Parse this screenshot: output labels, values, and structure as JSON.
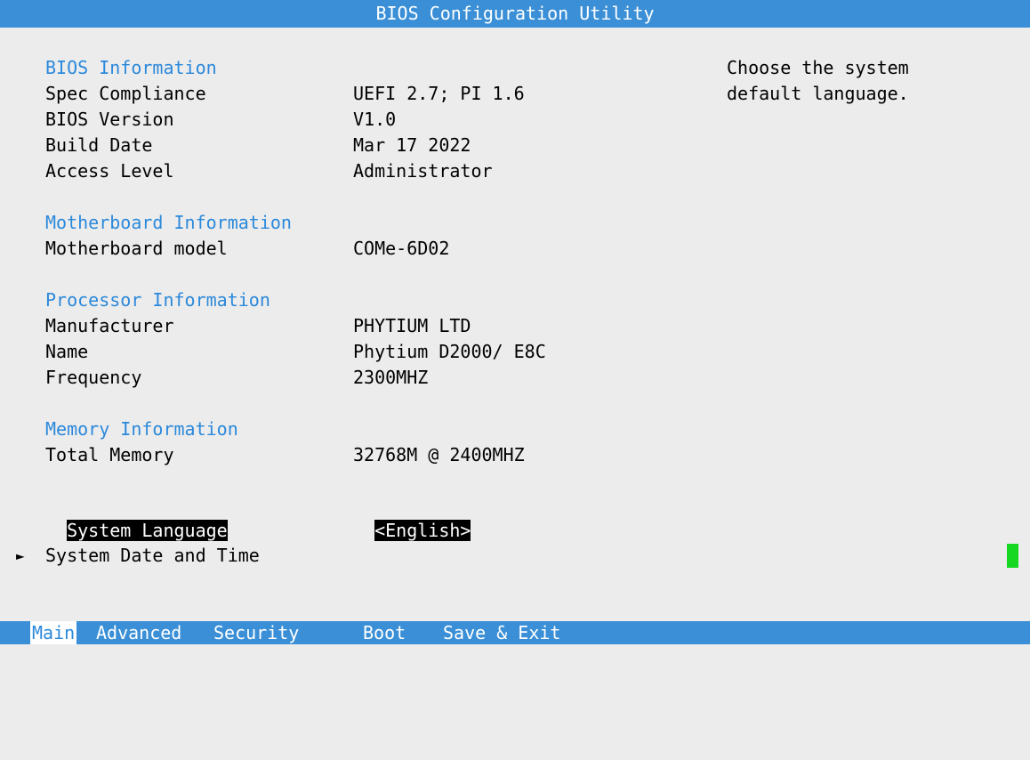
{
  "header": {
    "title": "BIOS Configuration Utility"
  },
  "sections": {
    "bios": {
      "heading": "BIOS Information",
      "rows": [
        {
          "label": "Spec Compliance",
          "value": "UEFI 2.7; PI 1.6"
        },
        {
          "label": "BIOS Version",
          "value": "V1.0"
        },
        {
          "label": "Build Date",
          "value": "Mar 17 2022"
        },
        {
          "label": "Access Level",
          "value": "Administrator"
        }
      ]
    },
    "motherboard": {
      "heading": "Motherboard Information",
      "rows": [
        {
          "label": "Motherboard model",
          "value": "COMe-6D02"
        }
      ]
    },
    "processor": {
      "heading": "Processor Information",
      "rows": [
        {
          "label": "Manufacturer",
          "value": "PHYTIUM LTD"
        },
        {
          "label": "Name",
          "value": "Phytium D2000/ E8C"
        },
        {
          "label": "Frequency",
          "value": "2300MHZ"
        }
      ]
    },
    "memory": {
      "heading": "Memory Information",
      "rows": [
        {
          "label": "Total Memory",
          "value": "32768M @ 2400MHZ"
        }
      ]
    }
  },
  "language": {
    "label": "System Language",
    "value": "<English>"
  },
  "date_time": {
    "label": "System Date and Time",
    "arrow": "►"
  },
  "help": {
    "line1": "Choose the system",
    "line2": "default language."
  },
  "tabs": [
    {
      "label": "Main",
      "active": true
    },
    {
      "label": "Advanced",
      "active": false
    },
    {
      "label": "Security",
      "active": false
    },
    {
      "label": "Boot",
      "active": false
    },
    {
      "label": "Save & Exit",
      "active": false
    }
  ],
  "colors": {
    "bar_blue": "#3a8fd6",
    "section_blue": "#2b89db",
    "background": "#ececec",
    "cursor_green": "#16d822"
  }
}
